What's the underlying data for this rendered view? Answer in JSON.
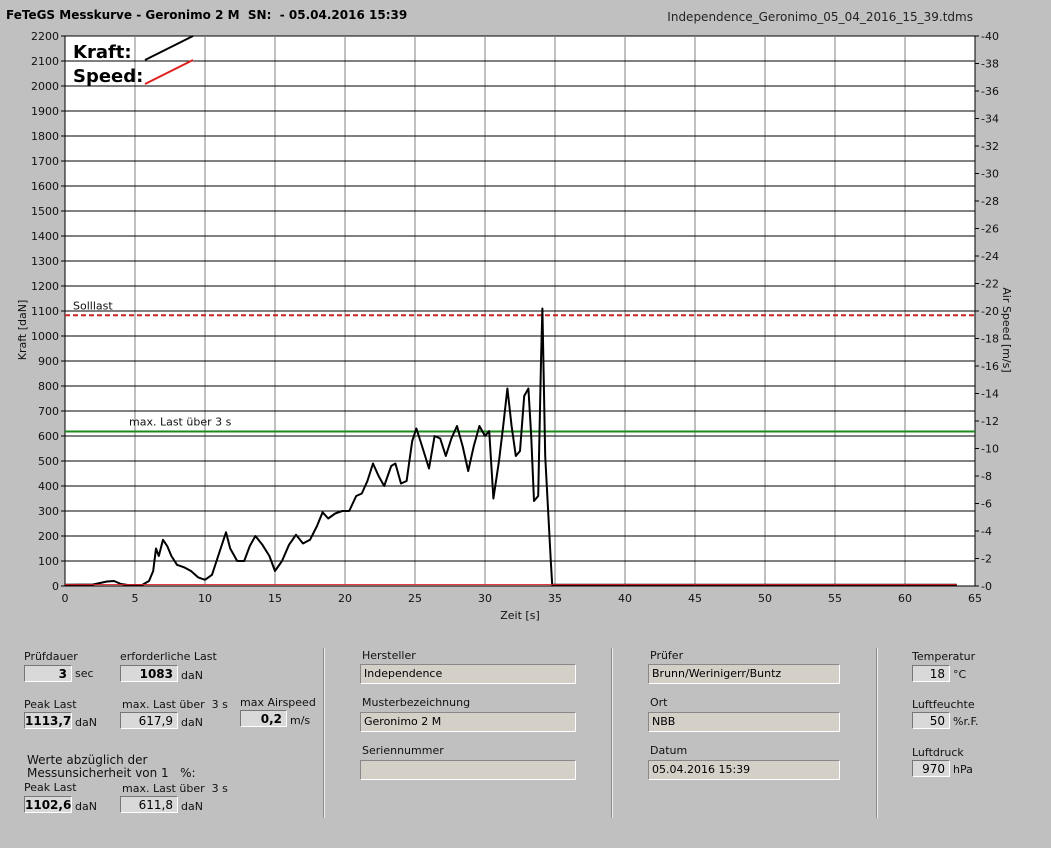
{
  "header": {
    "title": "FeTeGS Messkurve - Geronimo 2 M  SN:  - 05.04.2016 15:39",
    "filename": "Independence_Geronimo_05_04_2016_15_39.tdms"
  },
  "chart_data": {
    "type": "line",
    "xlabel": "Zeit [s]",
    "ylabel_left": "Kraft [daN]",
    "ylabel_right": "Air Speed [m/s]",
    "xlim": [
      0,
      65
    ],
    "ylim_left": [
      0,
      2200
    ],
    "ylim_right": [
      0,
      40
    ],
    "x_ticks": [
      0,
      5,
      10,
      15,
      20,
      25,
      30,
      35,
      40,
      45,
      50,
      55,
      60,
      65
    ],
    "y_ticks_left": [
      0,
      100,
      200,
      300,
      400,
      500,
      600,
      700,
      800,
      900,
      1000,
      1100,
      1200,
      1300,
      1400,
      1500,
      1600,
      1700,
      1800,
      1900,
      2000,
      2100,
      2200
    ],
    "y_ticks_right": [
      0,
      2,
      4,
      6,
      8,
      10,
      12,
      14,
      16,
      18,
      20,
      22,
      24,
      26,
      28,
      30,
      32,
      34,
      36,
      38,
      40
    ],
    "grid": true,
    "legend": [
      {
        "name": "Kraft:",
        "color": "#000000"
      },
      {
        "name": "Speed:",
        "color": "#e02020"
      }
    ],
    "reference_lines": [
      {
        "label": "Solllast",
        "value": 1083,
        "color": "#cc2020",
        "style": "dashed"
      },
      {
        "label": "max. Last über  3 s",
        "value": 617.9,
        "color": "#1a8a1a",
        "style": "solid"
      }
    ],
    "series": [
      {
        "name": "Kraft",
        "color": "#000000",
        "points": [
          [
            0,
            5
          ],
          [
            2,
            6
          ],
          [
            3,
            18
          ],
          [
            3.5,
            20
          ],
          [
            4,
            8
          ],
          [
            4.5,
            4
          ],
          [
            5.5,
            4
          ],
          [
            6,
            20
          ],
          [
            6.3,
            60
          ],
          [
            6.5,
            150
          ],
          [
            6.7,
            120
          ],
          [
            7,
            185
          ],
          [
            7.3,
            160
          ],
          [
            7.6,
            120
          ],
          [
            8,
            85
          ],
          [
            8.5,
            75
          ],
          [
            9,
            60
          ],
          [
            9.5,
            35
          ],
          [
            10,
            25
          ],
          [
            10.5,
            45
          ],
          [
            11,
            130
          ],
          [
            11.5,
            215
          ],
          [
            11.8,
            150
          ],
          [
            12.3,
            100
          ],
          [
            12.8,
            100
          ],
          [
            13.2,
            160
          ],
          [
            13.6,
            200
          ],
          [
            14.1,
            165
          ],
          [
            14.6,
            120
          ],
          [
            15,
            60
          ],
          [
            15.5,
            100
          ],
          [
            16,
            165
          ],
          [
            16.5,
            205
          ],
          [
            17,
            170
          ],
          [
            17.5,
            185
          ],
          [
            18,
            240
          ],
          [
            18.4,
            295
          ],
          [
            18.8,
            270
          ],
          [
            19.3,
            290
          ],
          [
            19.8,
            300
          ],
          [
            20.3,
            300
          ],
          [
            20.8,
            360
          ],
          [
            21.2,
            370
          ],
          [
            21.6,
            420
          ],
          [
            22,
            490
          ],
          [
            22.4,
            440
          ],
          [
            22.8,
            400
          ],
          [
            23.3,
            480
          ],
          [
            23.6,
            490
          ],
          [
            24,
            410
          ],
          [
            24.4,
            420
          ],
          [
            24.8,
            580
          ],
          [
            25.1,
            630
          ],
          [
            25.5,
            560
          ],
          [
            26,
            470
          ],
          [
            26.4,
            600
          ],
          [
            26.8,
            590
          ],
          [
            27.2,
            520
          ],
          [
            27.6,
            590
          ],
          [
            28,
            640
          ],
          [
            28.4,
            560
          ],
          [
            28.8,
            460
          ],
          [
            29.2,
            560
          ],
          [
            29.6,
            640
          ],
          [
            30,
            600
          ],
          [
            30.3,
            620
          ],
          [
            30.6,
            350
          ],
          [
            31,
            500
          ],
          [
            31.3,
            640
          ],
          [
            31.6,
            790
          ],
          [
            31.9,
            640
          ],
          [
            32.2,
            520
          ],
          [
            32.5,
            540
          ],
          [
            32.8,
            760
          ],
          [
            33.1,
            790
          ],
          [
            33.3,
            600
          ],
          [
            33.5,
            340
          ],
          [
            33.8,
            360
          ],
          [
            34,
            900
          ],
          [
            34.1,
            1110
          ],
          [
            34.3,
            520
          ],
          [
            34.5,
            310
          ],
          [
            34.7,
            100
          ],
          [
            34.8,
            5
          ],
          [
            40,
            5
          ],
          [
            50,
            5
          ],
          [
            60,
            5
          ],
          [
            63.7,
            5
          ]
        ]
      },
      {
        "name": "Speed",
        "color": "#e02020",
        "points": [
          [
            0,
            0.1
          ],
          [
            63.7,
            0.1
          ]
        ]
      }
    ]
  },
  "panel": {
    "pruefdauer": {
      "label": "Prüfdauer",
      "value": "3",
      "unit": "sec"
    },
    "erforderliche_last": {
      "label": "erforderliche Last",
      "value": "1083",
      "unit": "daN"
    },
    "peak_last": {
      "label": "Peak Last",
      "value": "1113,7",
      "unit": "daN"
    },
    "max_last_3s": {
      "label": "max. Last über  3 s",
      "value": "617,9",
      "unit": "daN"
    },
    "max_airspeed": {
      "label": "max Airspeed",
      "value": "0,2",
      "unit": "m/s"
    },
    "abzug_note": "Werte abzüglich der\nMessunsicherheit von 1   %:",
    "peak_last_corr": {
      "label": "Peak Last",
      "value": "1102,6",
      "unit": "daN"
    },
    "max_last_3s_corr": {
      "label": "max. Last über  3 s",
      "value": "611,8",
      "unit": "daN"
    },
    "hersteller": {
      "label": "Hersteller",
      "value": "Independence"
    },
    "musterbezeichnung": {
      "label": "Musterbezeichnung",
      "value": "Geronimo 2 M"
    },
    "seriennummer": {
      "label": "Seriennummer",
      "value": ""
    },
    "pruefer": {
      "label": "Prüfer",
      "value": "Brunn/Werinigerr/Buntz"
    },
    "ort": {
      "label": "Ort",
      "value": "NBB"
    },
    "datum": {
      "label": "Datum",
      "value": "05.04.2016 15:39"
    },
    "temperatur": {
      "label": "Temperatur",
      "value": "18",
      "unit": "°C"
    },
    "luftfeuchte": {
      "label": "Luftfeuchte",
      "value": "50",
      "unit": "%r.F."
    },
    "luftdruck": {
      "label": "Luftdruck",
      "value": "970",
      "unit": "hPa"
    }
  }
}
